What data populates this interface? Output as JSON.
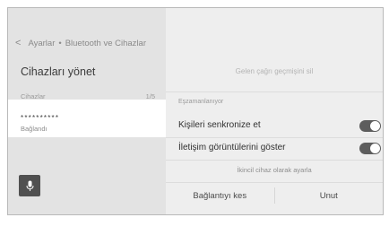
{
  "breadcrumb": {
    "back_glyph": "<",
    "items": [
      "Ayarlar",
      "Bluetooth ve Cihazlar"
    ],
    "separator": "•"
  },
  "page_title": "Cihazları yönet",
  "device_list": {
    "header_label": "Cihazlar",
    "count": "1/5",
    "devices": [
      {
        "name": "**********",
        "status": "Bağlandı",
        "selected": true
      }
    ]
  },
  "voice_button": {
    "icon": "microphone-icon"
  },
  "detail_panel": {
    "clear_history_label": "Gelen çağrı geçmişini sil",
    "sync_section_label": "Eşzamanlanıyor",
    "sync_contacts": {
      "label": "Kişileri senkronize et",
      "on": true
    },
    "show_contact_images": {
      "label": "İletişim görüntülerini göster",
      "on": true
    },
    "set_secondary_label": "İkincil cihaz olarak ayarla",
    "disconnect_label": "Bağlantıyı kes",
    "forget_label": "Unut"
  },
  "colors": {
    "toggle_on": "#5d5d5d",
    "panel_bg": "#eeeeee",
    "sidebar_bg": "#e3e3e3",
    "selected_item_bg": "#ffffff",
    "voice_button_bg": "#505050"
  }
}
